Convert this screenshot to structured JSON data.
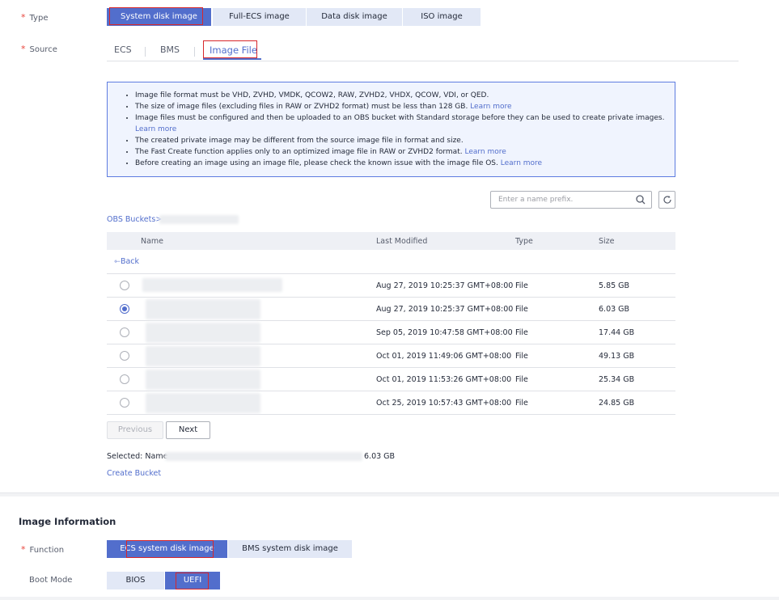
{
  "type_field": {
    "label": "Type",
    "options": [
      "System disk image",
      "Full-ECS image",
      "Data disk image",
      "ISO image"
    ],
    "selected": "System disk image"
  },
  "source_field": {
    "label": "Source",
    "tabs": [
      "ECS",
      "BMS",
      "Image File"
    ],
    "active_tab": "Image File"
  },
  "info_notes": {
    "items": [
      {
        "text": "Image file format must be VHD, ZVHD, VMDK, QCOW2, RAW, ZVHD2, VHDX, QCOW, VDI, or QED.",
        "link": ""
      },
      {
        "text": "The size of image files (excluding files in RAW or ZVHD2 format) must be less than 128 GB.",
        "link": "Learn more"
      },
      {
        "text": "Image files must be configured and then be uploaded to an OBS bucket with Standard storage before they can be used to create private images.",
        "link": "Learn more"
      },
      {
        "text": "The created private image may be different from the source image file in format and size.",
        "link": ""
      },
      {
        "text": "The Fast Create function applies only to an optimized image file in RAW or ZVHD2 format.",
        "link": "Learn more"
      },
      {
        "text": "Before creating an image using an image file, please check the known issue with the image file OS.",
        "link": "Learn more"
      }
    ]
  },
  "search": {
    "placeholder": "Enter a name prefix."
  },
  "breadcrumb": {
    "root": "OBS Buckets>"
  },
  "file_table": {
    "headers": [
      "Name",
      "Last Modified",
      "Type",
      "Size"
    ],
    "back_label": "Back",
    "rows": [
      {
        "modified": "Aug 27, 2019 10:25:37 GMT+08:00",
        "type": "File",
        "size": "5.85 GB",
        "selected": false
      },
      {
        "modified": "Aug 27, 2019 10:25:37 GMT+08:00",
        "type": "File",
        "size": "6.03 GB",
        "selected": true
      },
      {
        "modified": "Sep 05, 2019 10:47:58 GMT+08:00",
        "type": "File",
        "size": "17.44 GB",
        "selected": false
      },
      {
        "modified": "Oct 01, 2019 11:49:06 GMT+08:00",
        "type": "File",
        "size": "49.13 GB",
        "selected": false
      },
      {
        "modified": "Oct 01, 2019 11:53:26 GMT+08:00",
        "type": "File",
        "size": "25.34 GB",
        "selected": false
      },
      {
        "modified": "Oct 25, 2019 10:57:43 GMT+08:00",
        "type": "File",
        "size": "24.85 GB",
        "selected": false
      }
    ]
  },
  "pagination": {
    "previous_label": "Previous",
    "next_label": "Next"
  },
  "selection": {
    "label": "Selected: Name:",
    "size": "6.03 GB"
  },
  "create_bucket_link": "Create Bucket",
  "image_information": {
    "title": "Image Information",
    "function_label": "Function",
    "function_options": [
      "ECS system disk image",
      "BMS system disk image"
    ],
    "function_selected": "ECS system disk image",
    "boot_mode_label": "Boot Mode",
    "boot_mode_options": [
      "BIOS",
      "UEFI"
    ],
    "boot_mode_selected": "UEFI"
  },
  "colors": {
    "accent": "#526ecc",
    "highlight_box": "#d8272b",
    "info_border": "#5e7ce0"
  },
  "icons": {
    "search": "search-icon",
    "refresh": "refresh-icon",
    "back": "back-arrow-icon",
    "radio": "radio-button"
  }
}
